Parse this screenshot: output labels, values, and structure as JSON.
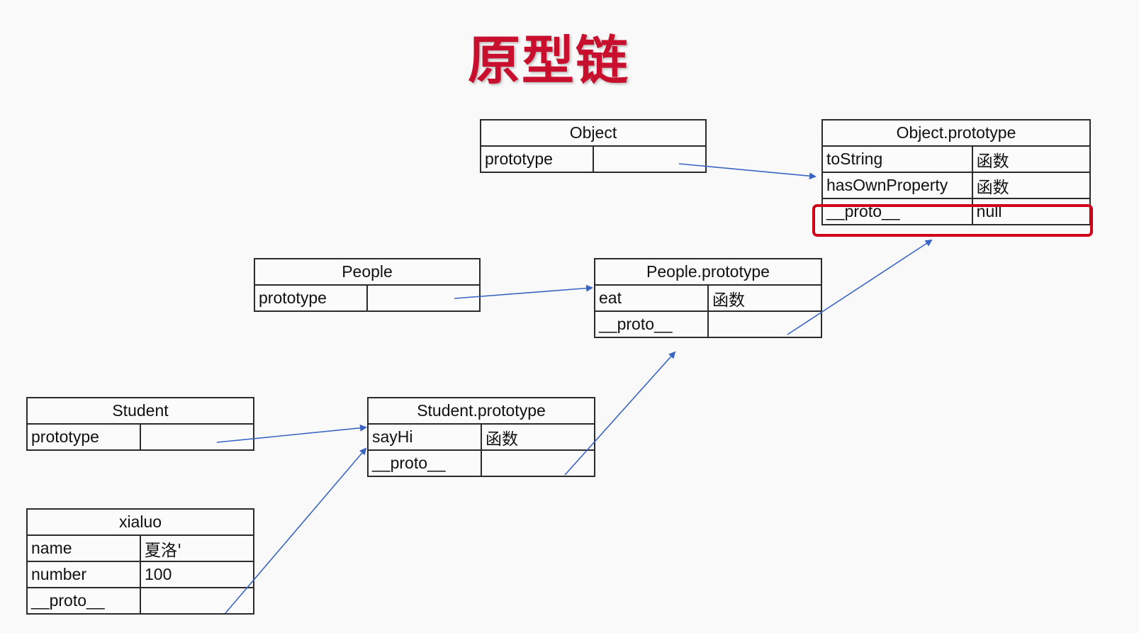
{
  "title": "原型链",
  "colors": {
    "title": "#c8102e",
    "arrow": "#3a64c4",
    "highlight": "#d0021b",
    "border": "#2b2b2b"
  },
  "tables": {
    "object": {
      "name": "Object",
      "rows": [
        {
          "key": "prototype",
          "value": ""
        }
      ]
    },
    "object_prototype": {
      "name": "Object.prototype",
      "rows": [
        {
          "key": "toString",
          "value": "函数"
        },
        {
          "key": "hasOwnProperty",
          "value": "函数"
        },
        {
          "key": "__proto__",
          "value": "null"
        }
      ]
    },
    "people": {
      "name": "People",
      "rows": [
        {
          "key": "prototype",
          "value": ""
        }
      ]
    },
    "people_prototype": {
      "name": "People.prototype",
      "rows": [
        {
          "key": "eat",
          "value": "函数"
        },
        {
          "key": "__proto__",
          "value": ""
        }
      ]
    },
    "student": {
      "name": "Student",
      "rows": [
        {
          "key": "prototype",
          "value": ""
        }
      ]
    },
    "student_prototype": {
      "name": "Student.prototype",
      "rows": [
        {
          "key": "sayHi",
          "value": "函数"
        },
        {
          "key": "__proto__",
          "value": ""
        }
      ]
    },
    "xialuo": {
      "name": "xialuo",
      "rows": [
        {
          "key": "name",
          "value": "夏洛'"
        },
        {
          "key": "number",
          "value": "100"
        },
        {
          "key": "__proto__",
          "value": ""
        }
      ]
    }
  },
  "arrows": [
    {
      "from": "Object.prototype",
      "to": "Object.prototype table"
    },
    {
      "from": "People.prototype",
      "to": "People.prototype table"
    },
    {
      "from": "Student.prototype",
      "to": "Student.prototype table"
    },
    {
      "from": "xialuo.__proto__",
      "to": "Student.prototype table"
    },
    {
      "from": "Student.prototype.__proto__",
      "to": "People.prototype table"
    },
    {
      "from": "People.prototype.__proto__",
      "to": "Object.prototype table"
    }
  ],
  "highlighted_row": "Object.prototype.__proto__ = null"
}
